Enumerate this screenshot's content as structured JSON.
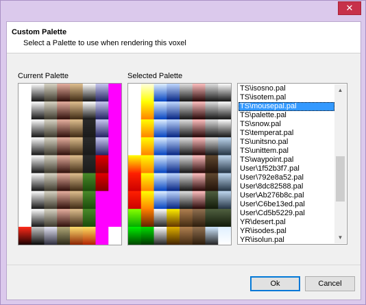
{
  "window": {
    "close_glyph": "✕"
  },
  "header": {
    "title": "Custom Palette",
    "subtitle": "Select a Palette to use when rendering this voxel"
  },
  "labels": {
    "current": "Current Palette",
    "selected": "Selected Palette"
  },
  "palette_list": {
    "items": [
      "TS\\isosno.pal",
      "TS\\isotem.pal",
      "TS\\mousepal.pal",
      "TS\\palette.pal",
      "TS\\snow.pal",
      "TS\\temperat.pal",
      "TS\\unitsno.pal",
      "TS\\unittem.pal",
      "TS\\waypoint.pal",
      "User\\1f52b3f7.pal",
      "User\\792e8a52.pal",
      "User\\8dc82588.pal",
      "User\\Ab276b8c.pal",
      "User\\C6be13ed.pal",
      "User\\Cd5b5229.pal",
      "YR\\desert.pal",
      "YR\\isodes.pal",
      "YR\\isolun.pal"
    ],
    "selected_index": 2
  },
  "buttons": {
    "ok": "Ok",
    "cancel": "Cancel"
  },
  "icons": {
    "scroll_up": "▲",
    "scroll_down": "▼"
  },
  "current_palette_columns": [
    [
      [
        "#ffffff",
        "#ffffff"
      ],
      [
        "#ffffff",
        "#ffffff"
      ],
      [
        "#ffffff",
        "#ffffff"
      ],
      [
        "#ffffff",
        "#ffffff"
      ],
      [
        "#ffffff",
        "#ffffff"
      ],
      [
        "#ffffff",
        "#ffffff"
      ],
      [
        "#ffffff",
        "#ffffff"
      ],
      [
        "#ffffff",
        "#ffffff"
      ],
      [
        "#ff2a1a",
        "#1a0000"
      ]
    ],
    [
      [
        "#ffffff",
        "#101010"
      ],
      [
        "#ffffff",
        "#101010"
      ],
      [
        "#ffffff",
        "#101010"
      ],
      [
        "#ffffff",
        "#101010"
      ],
      [
        "#ffffff",
        "#101010"
      ],
      [
        "#ffffff",
        "#101010"
      ],
      [
        "#ffffff",
        "#101010"
      ],
      [
        "#ffffff",
        "#101010"
      ],
      [
        "#c8c8c8",
        "#050505"
      ]
    ],
    [
      [
        "#d8d4c4",
        "#3a362a"
      ],
      [
        "#d8d4c4",
        "#3a362a"
      ],
      [
        "#d8d4c4",
        "#3a362a"
      ],
      [
        "#d8d4c4",
        "#3a362a"
      ],
      [
        "#d8d4c4",
        "#3a362a"
      ],
      [
        "#d8d4c4",
        "#3a362a"
      ],
      [
        "#d8d4c4",
        "#3a362a"
      ],
      [
        "#d8d4c4",
        "#3a362a"
      ],
      [
        "#e4e4f4",
        "#2a2a3a"
      ]
    ],
    [
      [
        "#e6b0a0",
        "#2a0a06"
      ],
      [
        "#e6b0a0",
        "#2a0a06"
      ],
      [
        "#e6b0a0",
        "#2a0a06"
      ],
      [
        "#e6b0a0",
        "#2a0a06"
      ],
      [
        "#e6b0a0",
        "#2a0a06"
      ],
      [
        "#e6b0a0",
        "#2a0a06"
      ],
      [
        "#e6b0a0",
        "#2a0a06"
      ],
      [
        "#e6b0a0",
        "#2a0a06"
      ],
      [
        "#b0a878",
        "#2a2616"
      ]
    ],
    [
      [
        "#e0c090",
        "#3a2610"
      ],
      [
        "#e0c090",
        "#3a2610"
      ],
      [
        "#e0c090",
        "#3a2610"
      ],
      [
        "#e0c090",
        "#3a2610"
      ],
      [
        "#e0c090",
        "#3a2610"
      ],
      [
        "#e0c090",
        "#3a2610"
      ],
      [
        "#e0c090",
        "#3a2610"
      ],
      [
        "#e0c090",
        "#3a2610"
      ],
      [
        "#ffe070",
        "#8a2000"
      ]
    ],
    [
      [
        "#ffffff",
        "#101010"
      ],
      [
        "#ffffff",
        "#101010"
      ],
      [
        "#2a2a2a",
        "#1a1a1a"
      ],
      [
        "#2a2a2a",
        "#1a1a1a"
      ],
      [
        "#2a2a2a",
        "#1a1a1a"
      ],
      [
        "#4a8a2a",
        "#1a4a0a"
      ],
      [
        "#4a8a2a",
        "#1a4a0a"
      ],
      [
        "#4a8a2a",
        "#1a4a0a"
      ],
      [
        "#ffe060",
        "#b02000"
      ]
    ],
    [
      [
        "#c8c8f0",
        "#202060"
      ],
      [
        "#c8c8f0",
        "#202060"
      ],
      [
        "#c8c8f0",
        "#202060"
      ],
      [
        "#c8c8f0",
        "#202060"
      ],
      [
        "#e00000",
        "#800000"
      ],
      [
        "#e00000",
        "#800000"
      ],
      [
        "#ff00ff",
        "#ff00ff"
      ],
      [
        "#ff00ff",
        "#ff00ff"
      ],
      [
        "#ff00ff",
        "#ff00ff"
      ]
    ],
    [
      [
        "#ff00ff",
        "#ff00ff"
      ],
      [
        "#ff00ff",
        "#ff00ff"
      ],
      [
        "#ff00ff",
        "#ff00ff"
      ],
      [
        "#ff00ff",
        "#ff00ff"
      ],
      [
        "#ff00ff",
        "#ff00ff"
      ],
      [
        "#ff00ff",
        "#ff00ff"
      ],
      [
        "#ff00ff",
        "#ff00ff"
      ],
      [
        "#ff00ff",
        "#ff00ff"
      ],
      [
        "#ffffff",
        "#ffffff"
      ]
    ]
  ],
  "selected_palette_columns": [
    [
      [
        "#ffffff",
        "#ffffff"
      ],
      [
        "#ffffff",
        "#ffffff"
      ],
      [
        "#ffffff",
        "#ffffff"
      ],
      [
        "#ffffff",
        "#ffffff"
      ],
      [
        "#ffff00",
        "#ff2000"
      ],
      [
        "#ff2000",
        "#cc0000"
      ],
      [
        "#ff2000",
        "#cc0000"
      ],
      [
        "#88ff00",
        "#00aa00"
      ],
      [
        "#00ee00",
        "#004400"
      ]
    ],
    [
      [
        "#ffffe0",
        "#ffff00"
      ],
      [
        "#ffff00",
        "#ff8000"
      ],
      [
        "#ffff00",
        "#ff8000"
      ],
      [
        "#ffff00",
        "#ff8000"
      ],
      [
        "#ffff00",
        "#ff8000"
      ],
      [
        "#ffff00",
        "#ff8000"
      ],
      [
        "#ffff00",
        "#ff8000"
      ],
      [
        "#ff8000",
        "#602000"
      ],
      [
        "#00dd00",
        "#003300"
      ]
    ],
    [
      [
        "#e0f0ff",
        "#0040c0"
      ],
      [
        "#e0f0ff",
        "#0040c0"
      ],
      [
        "#e0f0ff",
        "#0040c0"
      ],
      [
        "#e0f0ff",
        "#0040c0"
      ],
      [
        "#e0f0ff",
        "#0040c0"
      ],
      [
        "#e0f0ff",
        "#0040c0"
      ],
      [
        "#e0f0ff",
        "#0040c0"
      ],
      [
        "#ffffff",
        "#202020"
      ],
      [
        "#ffffff",
        "#202020"
      ]
    ],
    [
      [
        "#c0d8ff",
        "#002080"
      ],
      [
        "#c0d8ff",
        "#002080"
      ],
      [
        "#c0d8ff",
        "#002080"
      ],
      [
        "#c0d8ff",
        "#002080"
      ],
      [
        "#c0d8ff",
        "#002080"
      ],
      [
        "#c0d8ff",
        "#002080"
      ],
      [
        "#c0d8ff",
        "#002080"
      ],
      [
        "#ffee00",
        "#603000"
      ],
      [
        "#e0b000",
        "#402000"
      ]
    ],
    [
      [
        "#e0e0e0",
        "#101010"
      ],
      [
        "#e0e0e0",
        "#101010"
      ],
      [
        "#e0e0e0",
        "#101010"
      ],
      [
        "#e0e0e0",
        "#101010"
      ],
      [
        "#e0e0e0",
        "#101010"
      ],
      [
        "#e0e0e0",
        "#101010"
      ],
      [
        "#e0e0e0",
        "#101010"
      ],
      [
        "#b08050",
        "#402810"
      ],
      [
        "#b08050",
        "#402810"
      ]
    ],
    [
      [
        "#ffc0c0",
        "#200000"
      ],
      [
        "#ffc0c0",
        "#200000"
      ],
      [
        "#ffc0c0",
        "#200000"
      ],
      [
        "#ffc0c0",
        "#200000"
      ],
      [
        "#ffc0c0",
        "#200000"
      ],
      [
        "#ffc0c0",
        "#200000"
      ],
      [
        "#ffc0c0",
        "#200000"
      ],
      [
        "#907050",
        "#2a1a0a"
      ],
      [
        "#907050",
        "#2a1a0a"
      ]
    ],
    [
      [
        "#e0e0e0",
        "#101010"
      ],
      [
        "#e0e0e0",
        "#101010"
      ],
      [
        "#e0e0e0",
        "#101010"
      ],
      [
        "#e0e0e0",
        "#101010"
      ],
      [
        "#604830",
        "#201008"
      ],
      [
        "#604830",
        "#201008"
      ],
      [
        "#506040",
        "#101808"
      ],
      [
        "#506040",
        "#101808"
      ],
      [
        "#d0e8ff",
        "#202020"
      ]
    ],
    [
      [
        "#ffffff",
        "#101010"
      ],
      [
        "#ffffff",
        "#101010"
      ],
      [
        "#ffffff",
        "#101010"
      ],
      [
        "#c0d8f0",
        "#203040"
      ],
      [
        "#c0d8f0",
        "#203040"
      ],
      [
        "#c0d8f0",
        "#203040"
      ],
      [
        "#c0d8f0",
        "#203040"
      ],
      [
        "#506040",
        "#101808"
      ],
      [
        "#e0f0ff",
        "#ffffff"
      ]
    ]
  ]
}
